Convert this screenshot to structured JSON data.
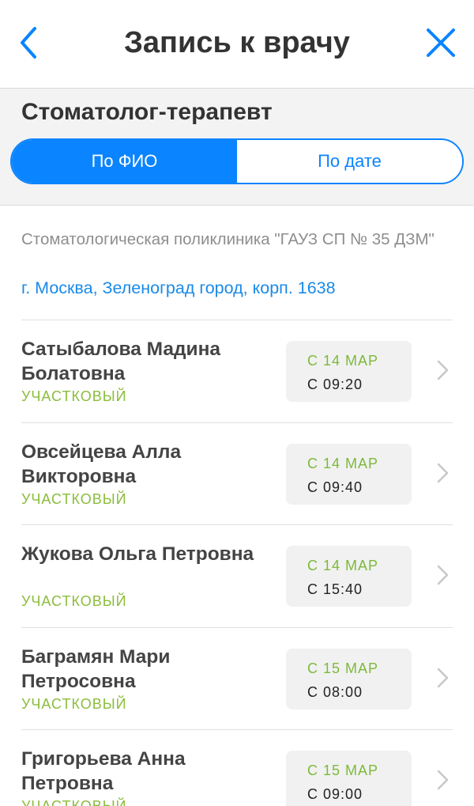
{
  "nav": {
    "title": "Запись к врачу",
    "back_icon": "chevron-left-icon",
    "close_icon": "close-icon"
  },
  "header": {
    "specialty": "Стоматолог-терапевт",
    "tabs": [
      {
        "label": "По ФИО",
        "active": true
      },
      {
        "label": "По дате",
        "active": false
      }
    ]
  },
  "clinic": {
    "name": "Стоматологическая поликлиника \"ГАУЗ СП № 35 ДЗМ\"",
    "address": "г. Москва, Зеленоград город, корп. 1638"
  },
  "doctors": [
    {
      "name": "Сатыбалова Мадина Болатовна",
      "role": "УЧАСТКОВЫЙ",
      "date": "С 14 МАР",
      "time": "С 09:20"
    },
    {
      "name": "Овсейцева Алла Викторовна",
      "role": "УЧАСТКОВЫЙ",
      "date": "С 14 МАР",
      "time": "С 09:40"
    },
    {
      "name": "Жукова Ольга Петровна",
      "role": "УЧАСТКОВЫЙ",
      "date": "С 14 МАР",
      "time": "С 15:40"
    },
    {
      "name": "Баграмян Мари Петросовна",
      "role": "УЧАСТКОВЫЙ",
      "date": "С 15 МАР",
      "time": "С 08:00"
    },
    {
      "name": "Григорьева Анна Петровна",
      "role": "УЧАСТКОВЫЙ",
      "date": "С 15 МАР",
      "time": "С 09:00"
    }
  ],
  "colors": {
    "accent": "#0a84ff",
    "link": "#1a8ae8",
    "role_green": "#8bbd3c"
  }
}
